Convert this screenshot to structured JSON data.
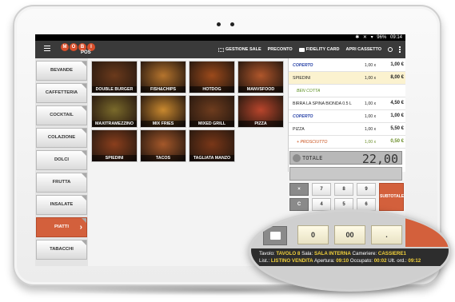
{
  "status_bar": {
    "icons": [
      "bluetooth-icon",
      "mute-icon",
      "wifi-icon"
    ],
    "battery": "96%",
    "time": "09:14"
  },
  "header": {
    "logo_letters": [
      "M",
      "O",
      "B",
      "I"
    ],
    "logo_sub": "POS",
    "actions": [
      {
        "label": "GESTIONE SALE",
        "icon": "grid-icon"
      },
      {
        "label": "PRECONTO",
        "icon": ""
      },
      {
        "label": "FIDELITY CARD",
        "icon": "card-icon"
      },
      {
        "label": "APRI CASSETTO",
        "icon": ""
      }
    ]
  },
  "categories": [
    {
      "label": "BEVANDE"
    },
    {
      "label": "CAFFETTERIA"
    },
    {
      "label": "COCKTAIL"
    },
    {
      "label": "COLAZIONE"
    },
    {
      "label": "DOLCI"
    },
    {
      "label": "FRUTTA"
    },
    {
      "label": "INSALATE"
    },
    {
      "label": "PIATTI",
      "active": true
    },
    {
      "label": "TABACCHI"
    }
  ],
  "products": [
    {
      "label": "DOUBLE BURGER",
      "color": "#6b3a1c"
    },
    {
      "label": "FISH&CHIPS",
      "color": "#b5742d"
    },
    {
      "label": "HOTDOG",
      "color": "#9c4a1b"
    },
    {
      "label": "MANVSFOOD",
      "color": "#b0562b"
    },
    {
      "label": "MAXITRAMEZZINO",
      "color": "#7a6a2b"
    },
    {
      "label": "MIX FRIES",
      "color": "#c9892f"
    },
    {
      "label": "MIXED GRILL",
      "color": "#6e3c1e"
    },
    {
      "label": "PIZZA",
      "color": "#b9452c"
    },
    {
      "label": "SPIEDINI",
      "color": "#8b3f1d"
    },
    {
      "label": "TACOS",
      "color": "#a5582a"
    },
    {
      "label": "TAGLIATA MANZO",
      "color": "#7a3718"
    }
  ],
  "orders": [
    {
      "name": "COPERTO",
      "qty": "1,00 x",
      "price": "1,00 €",
      "type": "coperto"
    },
    {
      "name": "SPIEDINI",
      "qty": "1,00 x",
      "price": "8,00 €",
      "type": "sel"
    },
    {
      "name": "BEN COTTA",
      "qty": "",
      "price": "",
      "type": "green"
    },
    {
      "name": "BIRRA LA SPINA BIONDA 0.5 L",
      "qty": "1,00 x",
      "price": "4,50 €",
      "type": "item"
    },
    {
      "name": "COPERTO",
      "qty": "1,00 x",
      "price": "1,00 €",
      "type": "coperto"
    },
    {
      "name": "PIZZA",
      "qty": "1,00 x",
      "price": "5,50 €",
      "type": "item"
    },
    {
      "name": "+ PROSCIUTTO",
      "qty": "1,00 x",
      "price": "0,50 €",
      "type": "note"
    }
  ],
  "total": {
    "label": "TOTALE",
    "value": "22,00"
  },
  "keypad": {
    "keys_row1": [
      "7",
      "8",
      "9"
    ],
    "keys_row2": [
      "C",
      "4",
      "5",
      "6"
    ],
    "subtotal": "SUBTOTALE",
    "clear": "×"
  },
  "zoom": {
    "keys": [
      "0",
      "00",
      "."
    ],
    "info_line1": {
      "tavolo_label": "Tavolo:",
      "tavolo": "TAVOLO 8",
      "sala_label": "Sala:",
      "sala": "SALA INTERNA",
      "cameriere_label": "Cameriere:",
      "cameriere": "CASSIERE1"
    },
    "info_line2": {
      "list_label": "List.:",
      "list": "LISTINO VENDITA",
      "apertura_label": "Apertura:",
      "apertura": "09:10",
      "occupato_label": "Occupato:",
      "occupato": "00:02",
      "ult_label": "Ult. ord.:",
      "ult": "09:12"
    }
  }
}
